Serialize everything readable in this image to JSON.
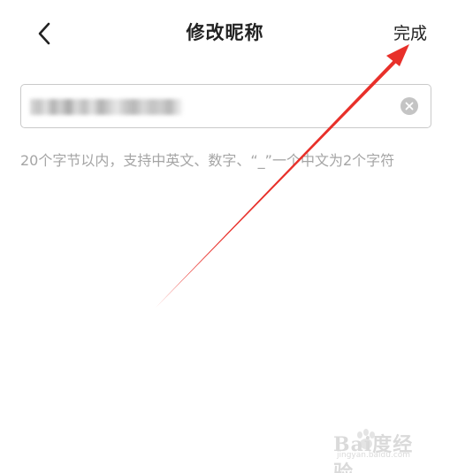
{
  "nav": {
    "title": "修改昵称",
    "done_label": "完成"
  },
  "nickname": {
    "value": "",
    "placeholder": ""
  },
  "hint": "20个字节以内，支持中英文、数字、“_”一个中文为2个字符",
  "watermark": {
    "brand": "Bai度经验",
    "url": "jingyan.baidu.com"
  },
  "colors": {
    "annotation_arrow": "#e8302a",
    "hint_text": "#a5a5a5",
    "title_text": "#222222"
  },
  "icons": {
    "back": "chevron-left-icon",
    "clear": "clear-circle-icon"
  }
}
